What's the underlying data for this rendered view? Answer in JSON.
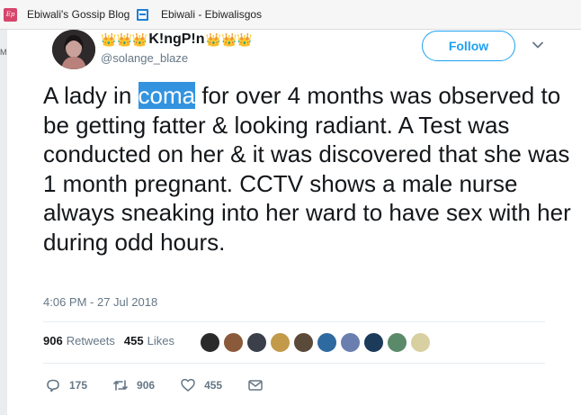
{
  "browser": {
    "bookmarks": [
      {
        "label": "Ebiwali's Gossip Blog",
        "icon": "ebiwali-favicon-icon"
      },
      {
        "label": "Ebiwali - Ebiwalisgos",
        "icon": "page-favicon-icon"
      }
    ]
  },
  "tweet": {
    "display_name": "K!ngP!n",
    "crown_glyph": "👑",
    "handle": "@solange_blaze",
    "follow_label": "Follow",
    "text_before": "A lady in ",
    "text_highlight": "coma",
    "text_after": " for over 4 months was observed to be getting fatter & looking radiant. A Test was conducted on her & it was discovered that she was 1 month pregnant. CCTV shows a male nurse always sneaking into her ward to have sex with her during odd hours.",
    "timestamp": "4:06 PM - 27 Jul 2018",
    "retweets_count": "906",
    "retweets_label": "Retweets",
    "likes_count": "455",
    "likes_label": "Likes",
    "likers": [
      "#2a2a2a",
      "#8a5a3a",
      "#3b3f4a",
      "#c29a4a",
      "#5a4a3a",
      "#2e6aa0",
      "#6a7fb0",
      "#1c3a5a",
      "#5a8a6a",
      "#d8d0a0"
    ],
    "actions": {
      "replies": "175",
      "retweets": "906",
      "likes": "455"
    },
    "colors": {
      "accent": "#1da1f2",
      "muted": "#657786",
      "highlight": "#3393df"
    }
  }
}
